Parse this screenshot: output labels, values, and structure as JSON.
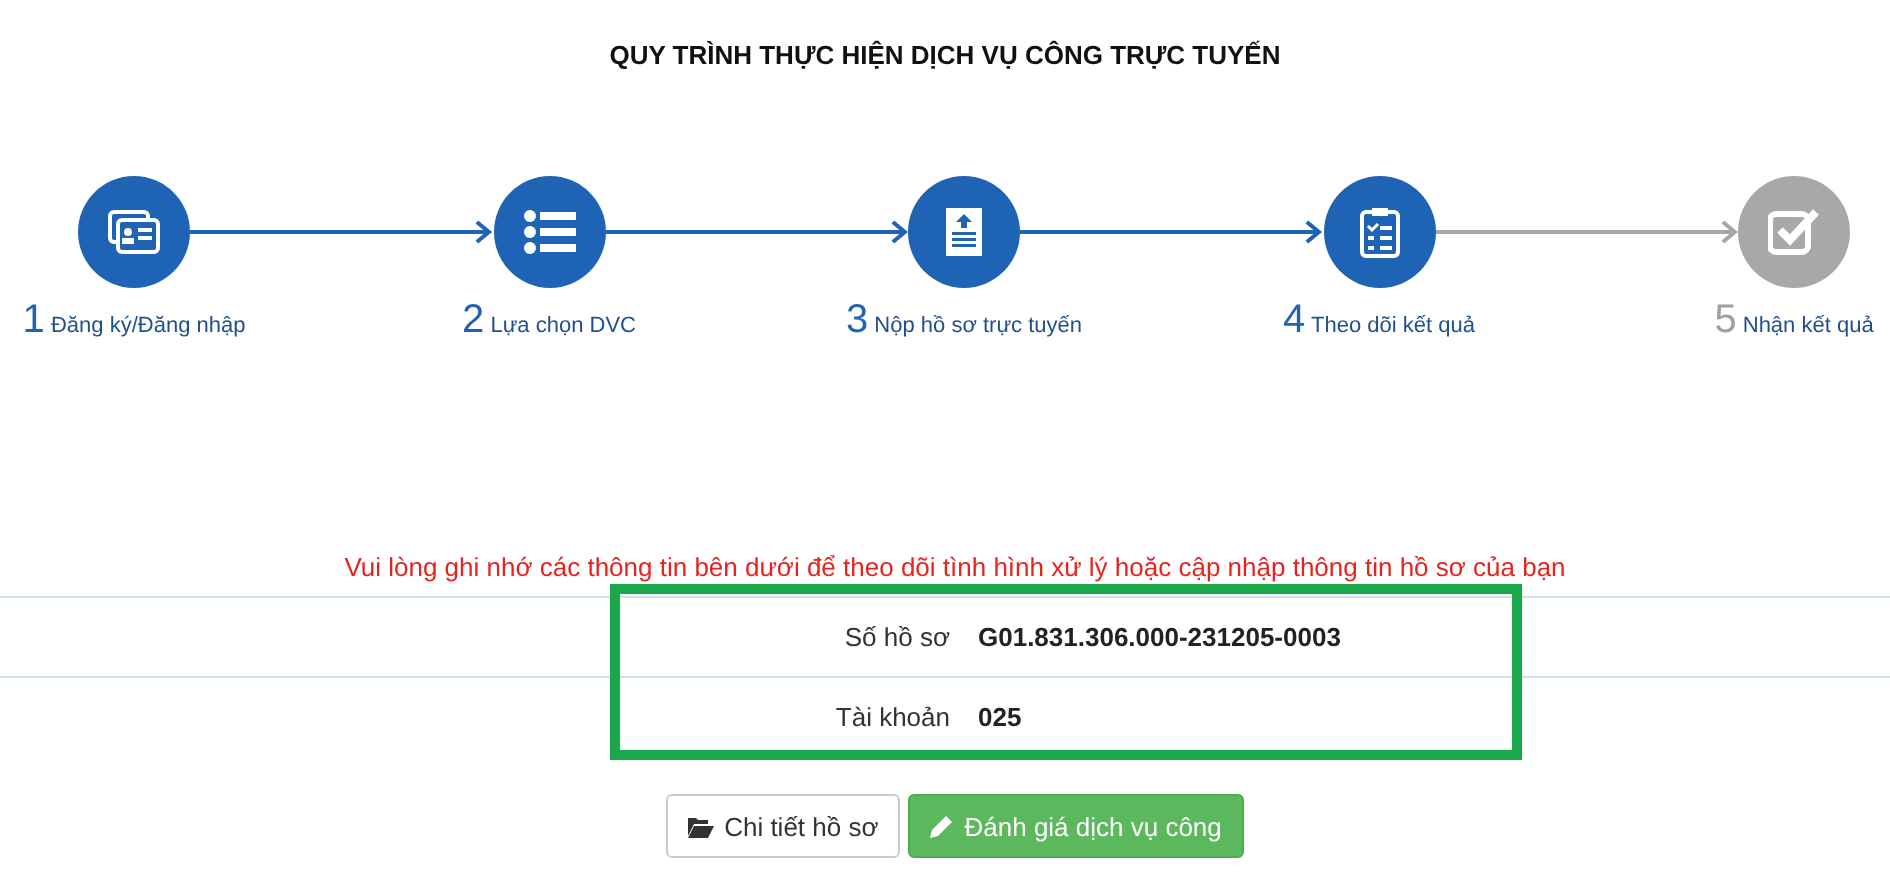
{
  "title": "QUY TRÌNH THỰC HIỆN DỊCH VỤ CÔNG TRỰC TUYẾN",
  "steps": [
    {
      "number": "1",
      "label": "Đăng ký/Đăng nhập",
      "kind": "id-card",
      "done": true
    },
    {
      "number": "2",
      "label": "Lựa chọn DVC",
      "kind": "list",
      "done": true
    },
    {
      "number": "3",
      "label": "Nộp hồ sơ trực tuyến",
      "kind": "document",
      "done": true
    },
    {
      "number": "4",
      "label": "Theo dõi kết quả",
      "kind": "clipboard",
      "done": true
    },
    {
      "number": "5",
      "label": "Nhận kết quả",
      "kind": "check",
      "done": false
    }
  ],
  "notice": "Vui lòng ghi nhớ các thông tin bên dưới để theo dõi tình hình xử lý hoặc cập nhập thông tin hồ sơ của bạn",
  "info_rows": [
    {
      "label": "Số hồ sơ",
      "value": "G01.831.306.000-231205-0003"
    },
    {
      "label": "Tài khoản",
      "value": "025"
    }
  ],
  "buttons": [
    {
      "label": "Chi tiết hồ sơ",
      "kind": "default"
    },
    {
      "label": "Đánh giá dịch vụ công",
      "kind": "success"
    }
  ]
}
